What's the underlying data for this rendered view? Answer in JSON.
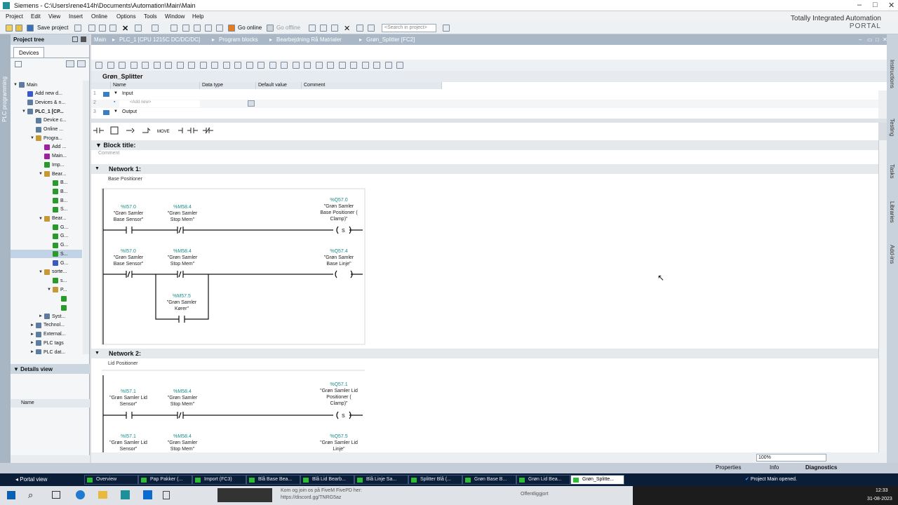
{
  "window": {
    "title": "Siemens - C:\\Users\\rene414h\\Documents\\Automation\\Main\\Main"
  },
  "menu": [
    "Project",
    "Edit",
    "View",
    "Insert",
    "Online",
    "Options",
    "Tools",
    "Window",
    "Help"
  ],
  "toolbar": {
    "save": "Save project",
    "go_online": "Go online",
    "go_offline": "Go offline",
    "search_placeholder": "<Search in project>"
  },
  "brand": {
    "line1": "Totally Integrated Automation",
    "line2": "PORTAL"
  },
  "left": {
    "strip": "PLC programming",
    "project_tree": "Project tree",
    "devices_tab": "Devices",
    "details_view": "Details view",
    "name_col": "Name",
    "tree": [
      {
        "label": "Main",
        "indent": 0,
        "icon": "d",
        "arr": "▼"
      },
      {
        "label": "Add new d...",
        "indent": 1,
        "icon": "b",
        "arr": ""
      },
      {
        "label": "Devices & n...",
        "indent": 1,
        "icon": "d",
        "arr": ""
      },
      {
        "label": "PLC_1 [CP...",
        "indent": 1,
        "icon": "d",
        "arr": "▼",
        "bold": true
      },
      {
        "label": "Device c...",
        "indent": 2,
        "icon": "d",
        "arr": ""
      },
      {
        "label": "Online ...",
        "indent": 2,
        "icon": "d",
        "arr": ""
      },
      {
        "label": "Progra...",
        "indent": 2,
        "icon": "f",
        "arr": "▼"
      },
      {
        "label": "Add ...",
        "indent": 3,
        "icon": "m",
        "arr": ""
      },
      {
        "label": "Main...",
        "indent": 3,
        "icon": "m",
        "arr": ""
      },
      {
        "label": "Imp...",
        "indent": 3,
        "icon": "g",
        "arr": ""
      },
      {
        "label": "Bear...",
        "indent": 3,
        "icon": "f",
        "arr": "▼"
      },
      {
        "label": "B...",
        "indent": 4,
        "icon": "g",
        "arr": ""
      },
      {
        "label": "B...",
        "indent": 4,
        "icon": "g",
        "arr": ""
      },
      {
        "label": "B...",
        "indent": 4,
        "icon": "g",
        "arr": ""
      },
      {
        "label": "S...",
        "indent": 4,
        "icon": "g",
        "arr": ""
      },
      {
        "label": "Bear...",
        "indent": 3,
        "icon": "f",
        "arr": "▼"
      },
      {
        "label": "G...",
        "indent": 4,
        "icon": "g",
        "arr": ""
      },
      {
        "label": "G...",
        "indent": 4,
        "icon": "g",
        "arr": ""
      },
      {
        "label": "G...",
        "indent": 4,
        "icon": "g",
        "arr": ""
      },
      {
        "label": "S...",
        "indent": 4,
        "icon": "g",
        "arr": "",
        "sel": true
      },
      {
        "label": "G...",
        "indent": 4,
        "icon": "b",
        "arr": ""
      },
      {
        "label": "sorte...",
        "indent": 3,
        "icon": "f",
        "arr": "▼"
      },
      {
        "label": "s...",
        "indent": 4,
        "icon": "g",
        "arr": ""
      },
      {
        "label": "P...",
        "indent": 4,
        "icon": "f",
        "arr": "▼"
      },
      {
        "label": "",
        "indent": 5,
        "icon": "g",
        "arr": ""
      },
      {
        "label": "",
        "indent": 5,
        "icon": "g",
        "arr": ""
      },
      {
        "label": "Syst...",
        "indent": 3,
        "icon": "d",
        "arr": "►"
      },
      {
        "label": "Technol...",
        "indent": 2,
        "icon": "d",
        "arr": "►"
      },
      {
        "label": "External...",
        "indent": 2,
        "icon": "d",
        "arr": "►"
      },
      {
        "label": "PLC tags",
        "indent": 2,
        "icon": "d",
        "arr": "►"
      },
      {
        "label": "PLC dat...",
        "indent": 2,
        "icon": "d",
        "arr": "►"
      }
    ]
  },
  "breadcrumb": [
    "Main",
    "PLC_1 [CPU 1215C DC/DC/DC]",
    "Program blocks",
    "Bearbejdning Rå Matrialer",
    "Grøn_Splitter [FC2]"
  ],
  "block_name": "Grøn_Splitter",
  "iface": {
    "cols": [
      "Name",
      "Data type",
      "Default value",
      "Comment"
    ],
    "rows": [
      {
        "n": "1",
        "name": "Input"
      },
      {
        "n": "2",
        "name": "<Add new>"
      },
      {
        "n": "3",
        "name": "Output"
      }
    ]
  },
  "editor": {
    "block_title": "Block title:",
    "comment": "Comment",
    "n1": {
      "title": "Network 1:",
      "comment": "Base Positioner"
    },
    "n2": {
      "title": "Network 2:",
      "comment": "Lid Positioner"
    },
    "c": [
      {
        "a": "%I57.0",
        "n1": "\"Grøn Samler",
        "n2": "Base Sensor\""
      },
      {
        "a": "%M58.4",
        "n1": "\"Grøn Samler",
        "n2": "Stop Mem\""
      },
      {
        "a": "%Q57.0",
        "n1": "\"Grøn Samler",
        "n2": "Base Positioner (",
        "n3": "Clamp)\""
      },
      {
        "a": "%I57.0",
        "n1": "\"Grøn Samler",
        "n2": "Base Sensor\""
      },
      {
        "a": "%M58.4",
        "n1": "\"Grøn Samler",
        "n2": "Stop Mem\""
      },
      {
        "a": "%Q57.4",
        "n1": "\"Grøn Samler",
        "n2": "Base Linje\""
      },
      {
        "a": "%M57.5",
        "n1": "\"Grøn Samler",
        "n2": "Kører\""
      },
      {
        "a": "%I57.1",
        "n1": "\"Grøn Samler Lid",
        "n2": "Sensor\""
      },
      {
        "a": "%M58.4",
        "n1": "\"Grøn Samler",
        "n2": "Stop Mem\""
      },
      {
        "a": "%Q57.1",
        "n1": "\"Grøn Samler Lid",
        "n2": "Positioner (",
        "n3": "Clamp)\""
      },
      {
        "a": "%I57.1",
        "n1": "\"Grøn Samler Lid",
        "n2": "Sensor\""
      },
      {
        "a": "%M58.4",
        "n1": "\"Grøn Samler",
        "n2": "Stop Mem\""
      },
      {
        "a": "%Q57.5",
        "n1": "\"Grøn Samler Lid",
        "n2": "Linje\""
      }
    ],
    "coil_s": "S",
    "move": "MOVE",
    "zoom": "100%"
  },
  "right_tabs": [
    "Instructions",
    "Testing",
    "Tasks",
    "Libraries",
    "Add-ins"
  ],
  "status_tabs": {
    "properties": "Properties",
    "info": "Info",
    "diagnostics": "Diagnostics"
  },
  "portal": {
    "view": "Portal view",
    "tabs": [
      "Overview",
      "Pap Pakker (...",
      "Import (FC3)",
      "Blå Base Bea...",
      "Blå Lid Bearb...",
      "Blå Linje Sa...",
      "Splitter Blå (...",
      "Grøn Base B...",
      "Grøn Lid Bea...",
      "Grøn_Splitte..."
    ],
    "status": "Project Main opened."
  },
  "taskbar": {
    "msg1": "Kom og join os på FiveM FivePD her:",
    "msg2": "https://discord.gg/TNRG5az",
    "msg3": "Offentliggjort",
    "time": "12:33",
    "date": "31-08-2023"
  }
}
